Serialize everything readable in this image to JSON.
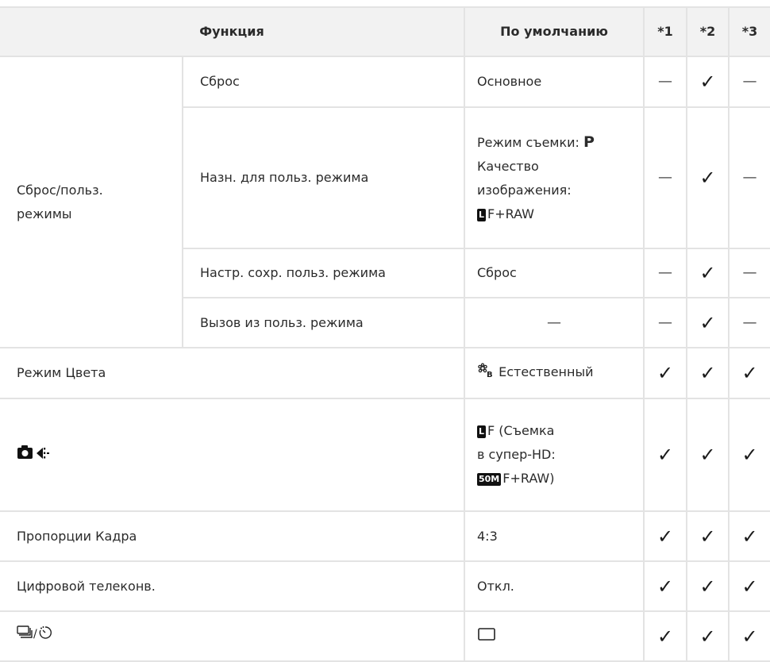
{
  "header": {
    "function": "Функция",
    "default": "По умолчанию",
    "c1": "*1",
    "c2": "*2",
    "c3": "*3"
  },
  "group_reset": "Сброс/польз.\nрежимы",
  "rows": [
    {
      "label": "Сброс",
      "default": "Основное",
      "c1": "—",
      "c2": "✓",
      "c3": "—"
    },
    {
      "label": "Назн. для польз. режима",
      "default_lines": [
        "Режим съемки: ",
        "P",
        "Качество",
        "изображения:",
        "L",
        "F+RAW"
      ],
      "c1": "—",
      "c2": "✓",
      "c3": "—"
    },
    {
      "label": "Настр. сохр. польз. режима",
      "default": "Сброс",
      "c1": "—",
      "c2": "✓",
      "c3": "—"
    },
    {
      "label": "Вызов из польз. режима",
      "default": "—",
      "c1": "—",
      "c2": "✓",
      "c3": "—"
    },
    {
      "label": "Режим Цвета",
      "default": "Естественный",
      "icon": "picture-mode-natural-icon",
      "c1": "✓",
      "c2": "✓",
      "c3": "✓"
    },
    {
      "icon": "camera-image-quality-icon",
      "default_lines": [
        "L",
        "F (Съемка",
        "в супер-HD:",
        "50M",
        "F+RAW)"
      ],
      "c1": "✓",
      "c2": "✓",
      "c3": "✓"
    },
    {
      "label": "Пропорции Кадра",
      "default": "4:3",
      "c1": "✓",
      "c2": "✓",
      "c3": "✓"
    },
    {
      "label": "Цифровой телеконв.",
      "default": "Откл.",
      "c1": "✓",
      "c2": "✓",
      "c3": "✓"
    },
    {
      "icon": "drive-self-timer-icon",
      "default_icon": "single-shot-icon",
      "c1": "✓",
      "c2": "✓",
      "c3": "✓"
    }
  ]
}
